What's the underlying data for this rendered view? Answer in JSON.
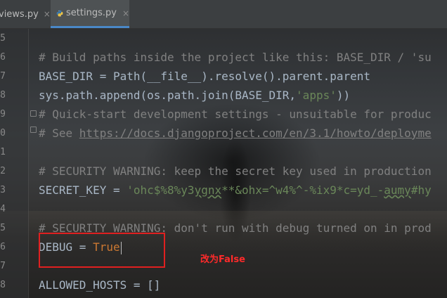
{
  "tabs": [
    {
      "label": "views.py",
      "close": "×",
      "active": false
    },
    {
      "label": "settings.py",
      "close": "×",
      "active": true
    }
  ],
  "gutter": {
    "line_numbers": [
      "5",
      "6",
      "7",
      "8",
      "9",
      "0",
      "1",
      "2",
      "3",
      "4",
      "5",
      "6",
      "7",
      "8",
      "9"
    ]
  },
  "code": {
    "l1_comment": "# Build paths inside the project like this: BASE_DIR / 'su",
    "l2": "BASE_DIR = Path(__file__).resolve().parent.parent",
    "l3_a": "sys.path.append(os.path.join(BASE_DIR,",
    "l3_str": "'apps'",
    "l3_b": "))",
    "l4_comment": "# Quick-start development settings - unsuitable for produc",
    "l5_prefix": "# See ",
    "l5_link": "https://docs.djangoproject.com/en/3.1/howto/deployme",
    "l6_comment": "# SECURITY WARNING: keep the secret key used in production",
    "l7_name": "SECRET_KEY = ",
    "l7_str_a": "'ohc$%8%y3",
    "l7_str_b": "ygnx",
    "l7_str_c": "**&ohx=^w4%^-%ix9*c=yd_-",
    "l7_str_d": "aumy",
    "l7_str_e": "#hy",
    "l8_comment": "# SECURITY WARNING: don't run with debug turned on in prod",
    "l9_name": "DEBUG = ",
    "l9_value": "True",
    "l10": "ALLOWED_HOSTS = []"
  },
  "annotation": {
    "text": "改为False",
    "color": "#ff2a2a"
  },
  "colors": {
    "comment": "#808080",
    "string": "#6a8759",
    "keyword": "#cc7832",
    "default": "#a9b7c6",
    "tab_accent": "#4a88c7"
  },
  "icons": {
    "python_file": "python-file-icon",
    "close": "close-icon"
  }
}
